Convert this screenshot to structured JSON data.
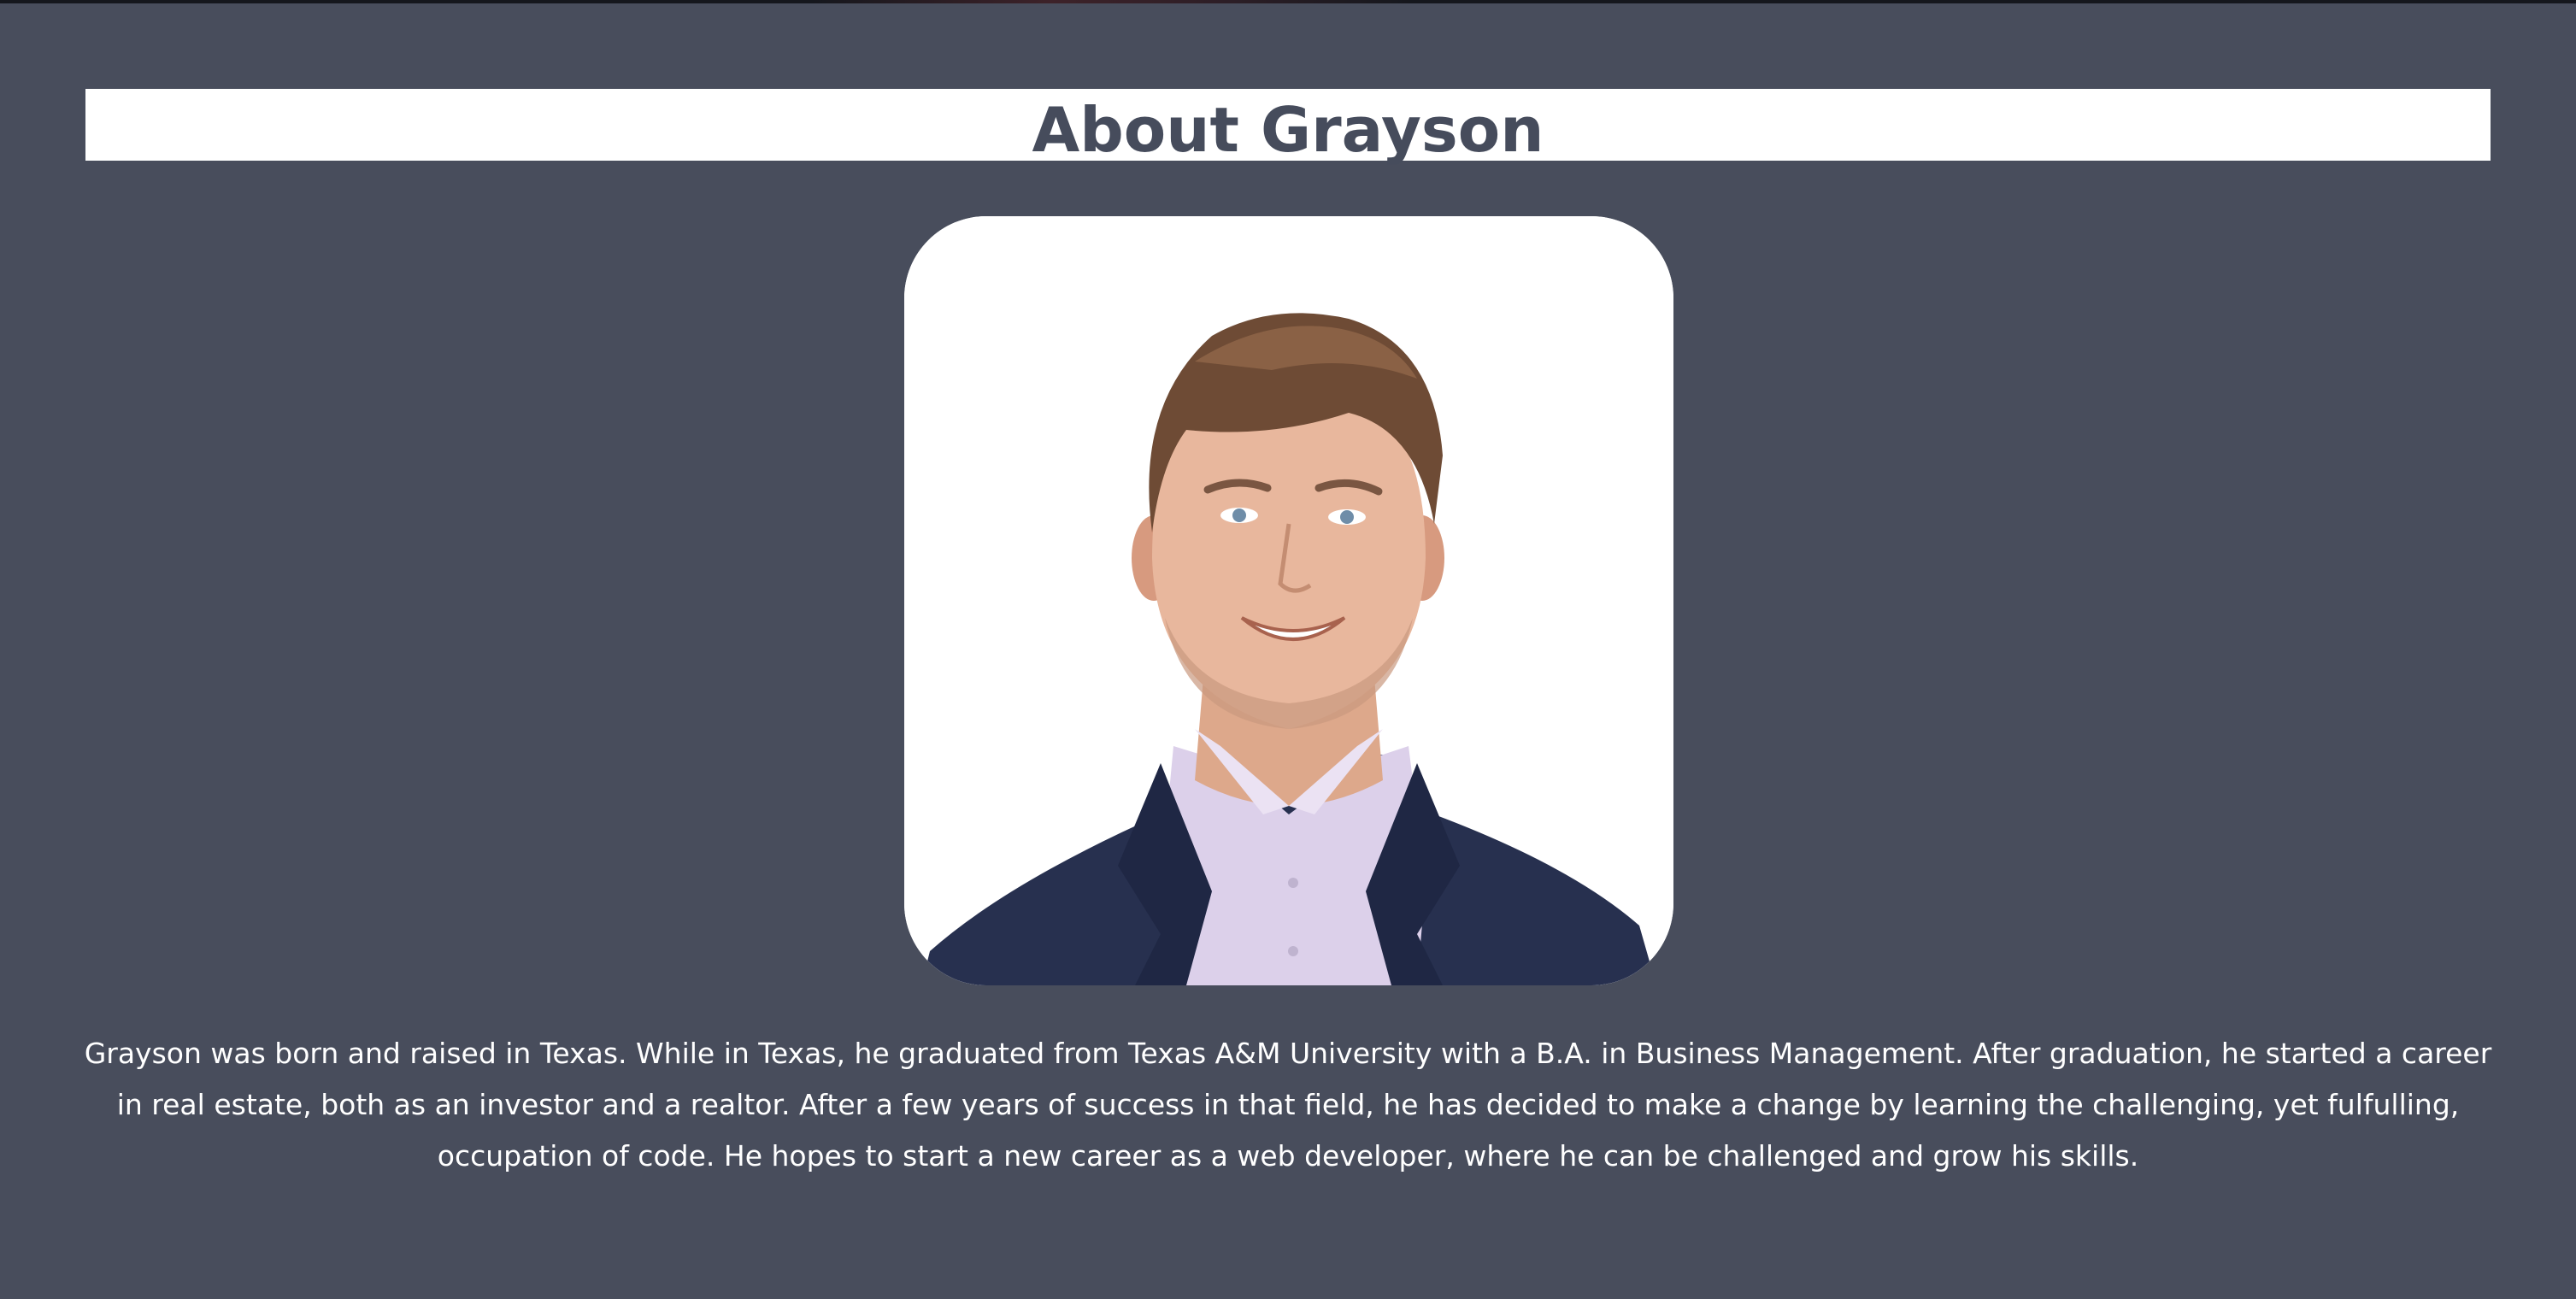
{
  "about": {
    "heading": "About Grayson",
    "portrait_icon": "portrait-photo-icon",
    "bio": "Grayson was born and raised in Texas. While in Texas, he graduated from Texas A&M University with a B.A. in Business Management. After graduation, he started a career in real estate, both as an investor and a realtor. After a few years of success in that field, he has decided to make a change by learning the challenging, yet fulfulling, occupation of code. He hopes to start a new career as a web developer, where he can be challenged and grow his skills."
  },
  "colors": {
    "page_background": "#484d5c",
    "heading_background": "#ffffff",
    "heading_text": "#464c5c",
    "body_text": "#ffffff"
  }
}
